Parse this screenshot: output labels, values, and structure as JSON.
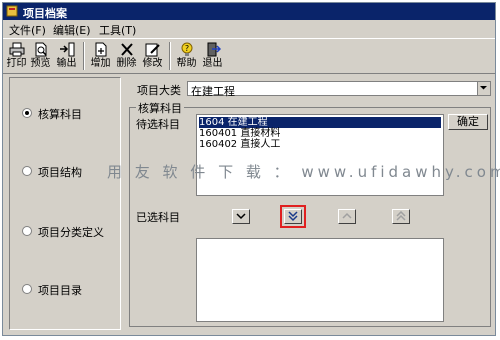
{
  "window": {
    "title": "项目档案"
  },
  "menu": [
    "文件(F)",
    "编辑(E)",
    "工具(T)"
  ],
  "toolbar": [
    {
      "name": "print",
      "label": "打印"
    },
    {
      "name": "preview",
      "label": "预览"
    },
    {
      "name": "export",
      "label": "输出"
    },
    {
      "name": "add",
      "label": "增加"
    },
    {
      "name": "delete",
      "label": "删除"
    },
    {
      "name": "modify",
      "label": "修改"
    },
    {
      "name": "help",
      "label": "帮助"
    },
    {
      "name": "exit",
      "label": "退出"
    }
  ],
  "left_options": [
    {
      "label": "核算科目",
      "selected": true
    },
    {
      "label": "项目结构",
      "selected": false
    },
    {
      "label": "项目分类定义",
      "selected": false
    },
    {
      "label": "项目目录",
      "selected": false
    }
  ],
  "project_category": {
    "label": "项目大类",
    "value": "在建工程"
  },
  "group": {
    "title": "核算科目",
    "pending_label": "待选科目",
    "pending_items": [
      {
        "code": "1604",
        "name": "在建工程",
        "highlighted": true
      },
      {
        "code": "160401",
        "name": "直接材料",
        "highlighted": false
      },
      {
        "code": "160402",
        "name": "直接人工",
        "highlighted": false
      }
    ],
    "confirm_button": "确定",
    "selected_label": "已选科目"
  },
  "watermark": "用 友 软 件 下 载 ： www.ufidawhy.com",
  "colors": {
    "title_bar": "#0a246a",
    "highlight": "#0a246a",
    "annotation_box": "#e02020",
    "window_bg": "#d4d0c8"
  }
}
